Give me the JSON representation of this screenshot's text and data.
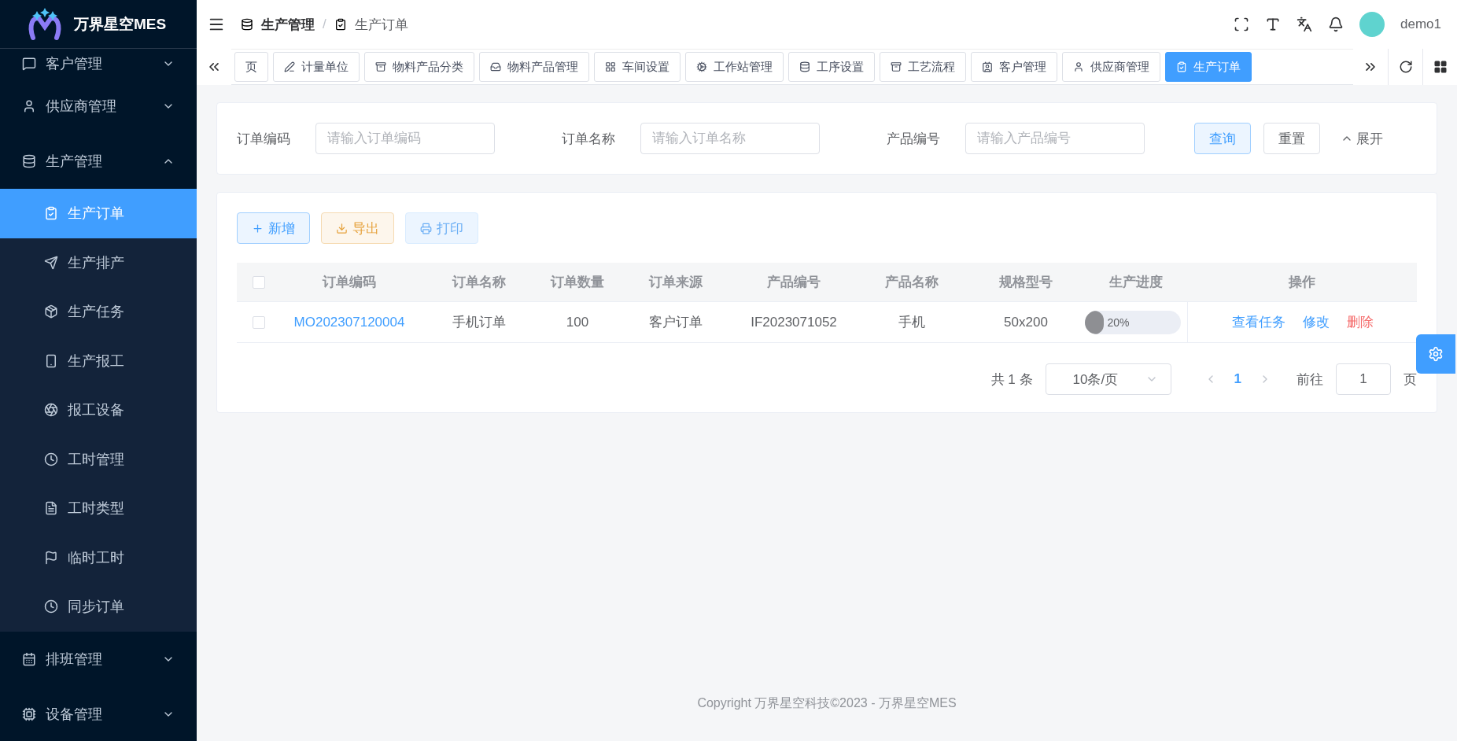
{
  "sidebar": {
    "logo_text": "万界星空MES",
    "menu": [
      {
        "label": "客户管理",
        "expanded": false
      },
      {
        "label": "供应商管理",
        "expanded": false
      },
      {
        "label": "生产管理",
        "expanded": true,
        "children": [
          {
            "label": "生产订单",
            "selected": true
          },
          {
            "label": "生产排产",
            "selected": false
          },
          {
            "label": "生产任务",
            "selected": false
          },
          {
            "label": "生产报工",
            "selected": false
          },
          {
            "label": "报工设备",
            "selected": false
          },
          {
            "label": "工时管理",
            "selected": false
          },
          {
            "label": "工时类型",
            "selected": false
          },
          {
            "label": "临时工时",
            "selected": false
          },
          {
            "label": "同步订单",
            "selected": false
          }
        ]
      },
      {
        "label": "排班管理",
        "expanded": false
      },
      {
        "label": "设备管理",
        "expanded": false
      }
    ]
  },
  "header": {
    "breadcrumb": [
      "生产管理",
      "生产订单"
    ],
    "breadcrumb_separator": "/",
    "user": "demo1"
  },
  "tabs": [
    {
      "label": "页",
      "selected": false
    },
    {
      "label": "计量单位",
      "selected": false
    },
    {
      "label": "物料产品分类",
      "selected": false
    },
    {
      "label": "物料产品管理",
      "selected": false
    },
    {
      "label": "车间设置",
      "selected": false
    },
    {
      "label": "工作站管理",
      "selected": false
    },
    {
      "label": "工序设置",
      "selected": false
    },
    {
      "label": "工艺流程",
      "selected": false
    },
    {
      "label": "客户管理",
      "selected": false
    },
    {
      "label": "供应商管理",
      "selected": false
    },
    {
      "label": "生产订单",
      "selected": true
    }
  ],
  "filters": [
    {
      "label": "订单编码",
      "placeholder": "请输入订单编码"
    },
    {
      "label": "订单名称",
      "placeholder": "请输入订单名称"
    },
    {
      "label": "产品编号",
      "placeholder": "请输入产品编号"
    }
  ],
  "filter_buttons": {
    "search": "查询",
    "reset": "重置",
    "expand": "展开"
  },
  "toolbar": [
    {
      "label": "新增",
      "kind": "add",
      "disabled": false
    },
    {
      "label": "导出",
      "kind": "export",
      "disabled": false
    },
    {
      "label": "打印",
      "kind": "print",
      "disabled": true
    }
  ],
  "table": {
    "select_all_checked": false,
    "columns": [
      "订单编码",
      "订单名称",
      "订单数量",
      "订单来源",
      "产品编号",
      "产品名称",
      "规格型号",
      "生产进度",
      "操作"
    ],
    "rows": [
      {
        "checked": false,
        "code": "MO202307120004",
        "name": "手机订单",
        "quantity": "100",
        "source": "客户订单",
        "product_code": "IF2023071052",
        "product_name": "手机",
        "spec": "50x200",
        "progress": {
          "level": 0.2,
          "text": "20%"
        },
        "actions": [
          {
            "label": "查看任务",
            "kind": "primary"
          },
          {
            "label": "修改",
            "kind": "primary"
          },
          {
            "label": "删除",
            "kind": "danger"
          }
        ]
      }
    ]
  },
  "pagination": {
    "total": "共 1 条",
    "page_size": "10条/页",
    "pages": [
      {
        "label": "1",
        "selected": true
      }
    ],
    "goto_label": "前往",
    "goto_value": "1",
    "goto_suffix": "页"
  },
  "footer": "Copyright 万界星空科技©2023 - 万界星空MES"
}
